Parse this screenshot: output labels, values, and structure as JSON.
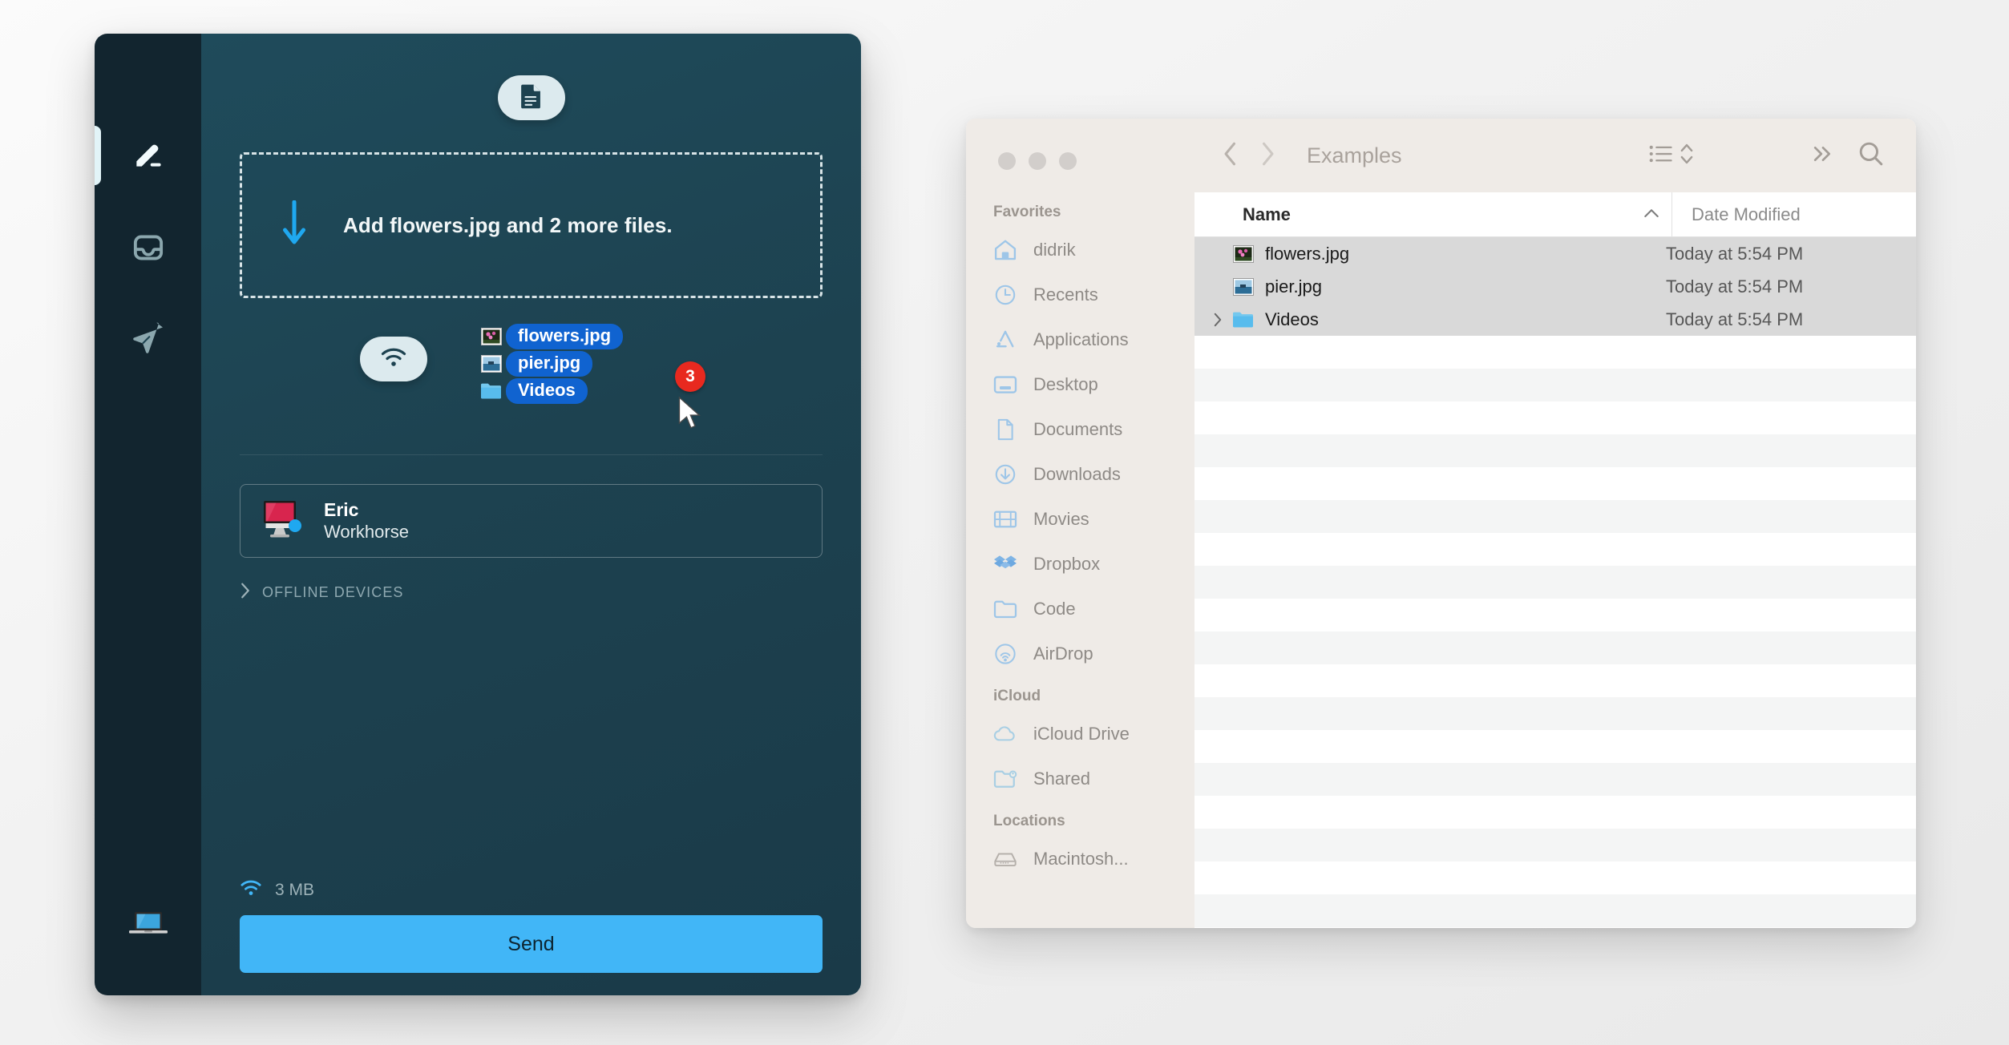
{
  "app": {
    "sidebar": {
      "items": [
        {
          "name": "compose",
          "icon": "pencil-icon",
          "active": true
        },
        {
          "name": "inbox",
          "icon": "inbox-tray-icon",
          "active": false
        },
        {
          "name": "sent",
          "icon": "paper-plane-icon",
          "active": false
        }
      ],
      "device_icon": "macbook-icon"
    },
    "header_icon": "document-icon",
    "dropzone": {
      "arrow_icon": "arrow-down-icon",
      "text": "Add flowers.jpg and 2 more files."
    },
    "wifi_pill_icon": "wifi-icon",
    "drag_ghost": {
      "badge_count": "3",
      "cursor_icon": "mouse-pointer-icon",
      "items": [
        {
          "label": "flowers.jpg",
          "icon": "photo-thumbnail-flowers"
        },
        {
          "label": "pier.jpg",
          "icon": "photo-thumbnail-pier"
        },
        {
          "label": "Videos",
          "icon": "folder-icon"
        }
      ]
    },
    "device": {
      "icon": "imac-icon",
      "name": "Eric",
      "subtitle": "Workhorse",
      "status": "online"
    },
    "offline_section": {
      "chevron_icon": "chevron-right-icon",
      "label": "OFFLINE DEVICES"
    },
    "status_bar": {
      "icon": "wifi-icon",
      "size": "3 MB"
    },
    "send_label": "Send",
    "colors": {
      "accent": "#41b6f7",
      "arrow_blue": "#1fa8f0",
      "drag_blue": "#1063d0",
      "badge_red": "#e8291f",
      "window_bg": "#1d4250",
      "sidebar_bg": "#12252f"
    }
  },
  "finder": {
    "title": "Examples",
    "traffic_lights": [
      "close",
      "minimize",
      "zoom"
    ],
    "toolbar": {
      "back_icon": "chevron-left-icon",
      "forward_icon": "chevron-right-icon",
      "view_list_icon": "list-view-icon",
      "view_stepper_icon": "chevron-updown-icon",
      "overflow_icon": "double-chevron-right-icon",
      "search_icon": "search-icon"
    },
    "columns": [
      {
        "label": "Name",
        "sort_icon": "chevron-up-icon"
      },
      {
        "label": "Date Modified"
      }
    ],
    "rows": [
      {
        "name": "flowers.jpg",
        "date": "Today at 5:54 PM",
        "icon": "photo-thumbnail-flowers",
        "selected": true,
        "disclosure": false
      },
      {
        "name": "pier.jpg",
        "date": "Today at 5:54 PM",
        "icon": "photo-thumbnail-pier",
        "selected": true,
        "disclosure": false
      },
      {
        "name": "Videos",
        "date": "Today at 5:54 PM",
        "icon": "folder-icon",
        "selected": true,
        "disclosure": true
      }
    ],
    "empty_row_count": 21,
    "sidebar": [
      {
        "type": "section",
        "label": "Favorites"
      },
      {
        "type": "item",
        "label": "didrik",
        "icon": "home-icon"
      },
      {
        "type": "item",
        "label": "Recents",
        "icon": "clock-icon"
      },
      {
        "type": "item",
        "label": "Applications",
        "icon": "applications-icon"
      },
      {
        "type": "item",
        "label": "Desktop",
        "icon": "desktop-icon"
      },
      {
        "type": "item",
        "label": "Documents",
        "icon": "document-icon"
      },
      {
        "type": "item",
        "label": "Downloads",
        "icon": "download-icon"
      },
      {
        "type": "item",
        "label": "Movies",
        "icon": "film-icon"
      },
      {
        "type": "item",
        "label": "Dropbox",
        "icon": "dropbox-icon"
      },
      {
        "type": "item",
        "label": "Code",
        "icon": "folder-outline-icon"
      },
      {
        "type": "item",
        "label": "AirDrop",
        "icon": "airdrop-icon"
      },
      {
        "type": "section",
        "label": "iCloud"
      },
      {
        "type": "item",
        "label": "iCloud Drive",
        "icon": "cloud-icon"
      },
      {
        "type": "item",
        "label": "Shared",
        "icon": "shared-folder-icon"
      },
      {
        "type": "section",
        "label": "Locations"
      },
      {
        "type": "item",
        "label": "Macintosh...",
        "icon": "harddisk-icon"
      }
    ]
  }
}
